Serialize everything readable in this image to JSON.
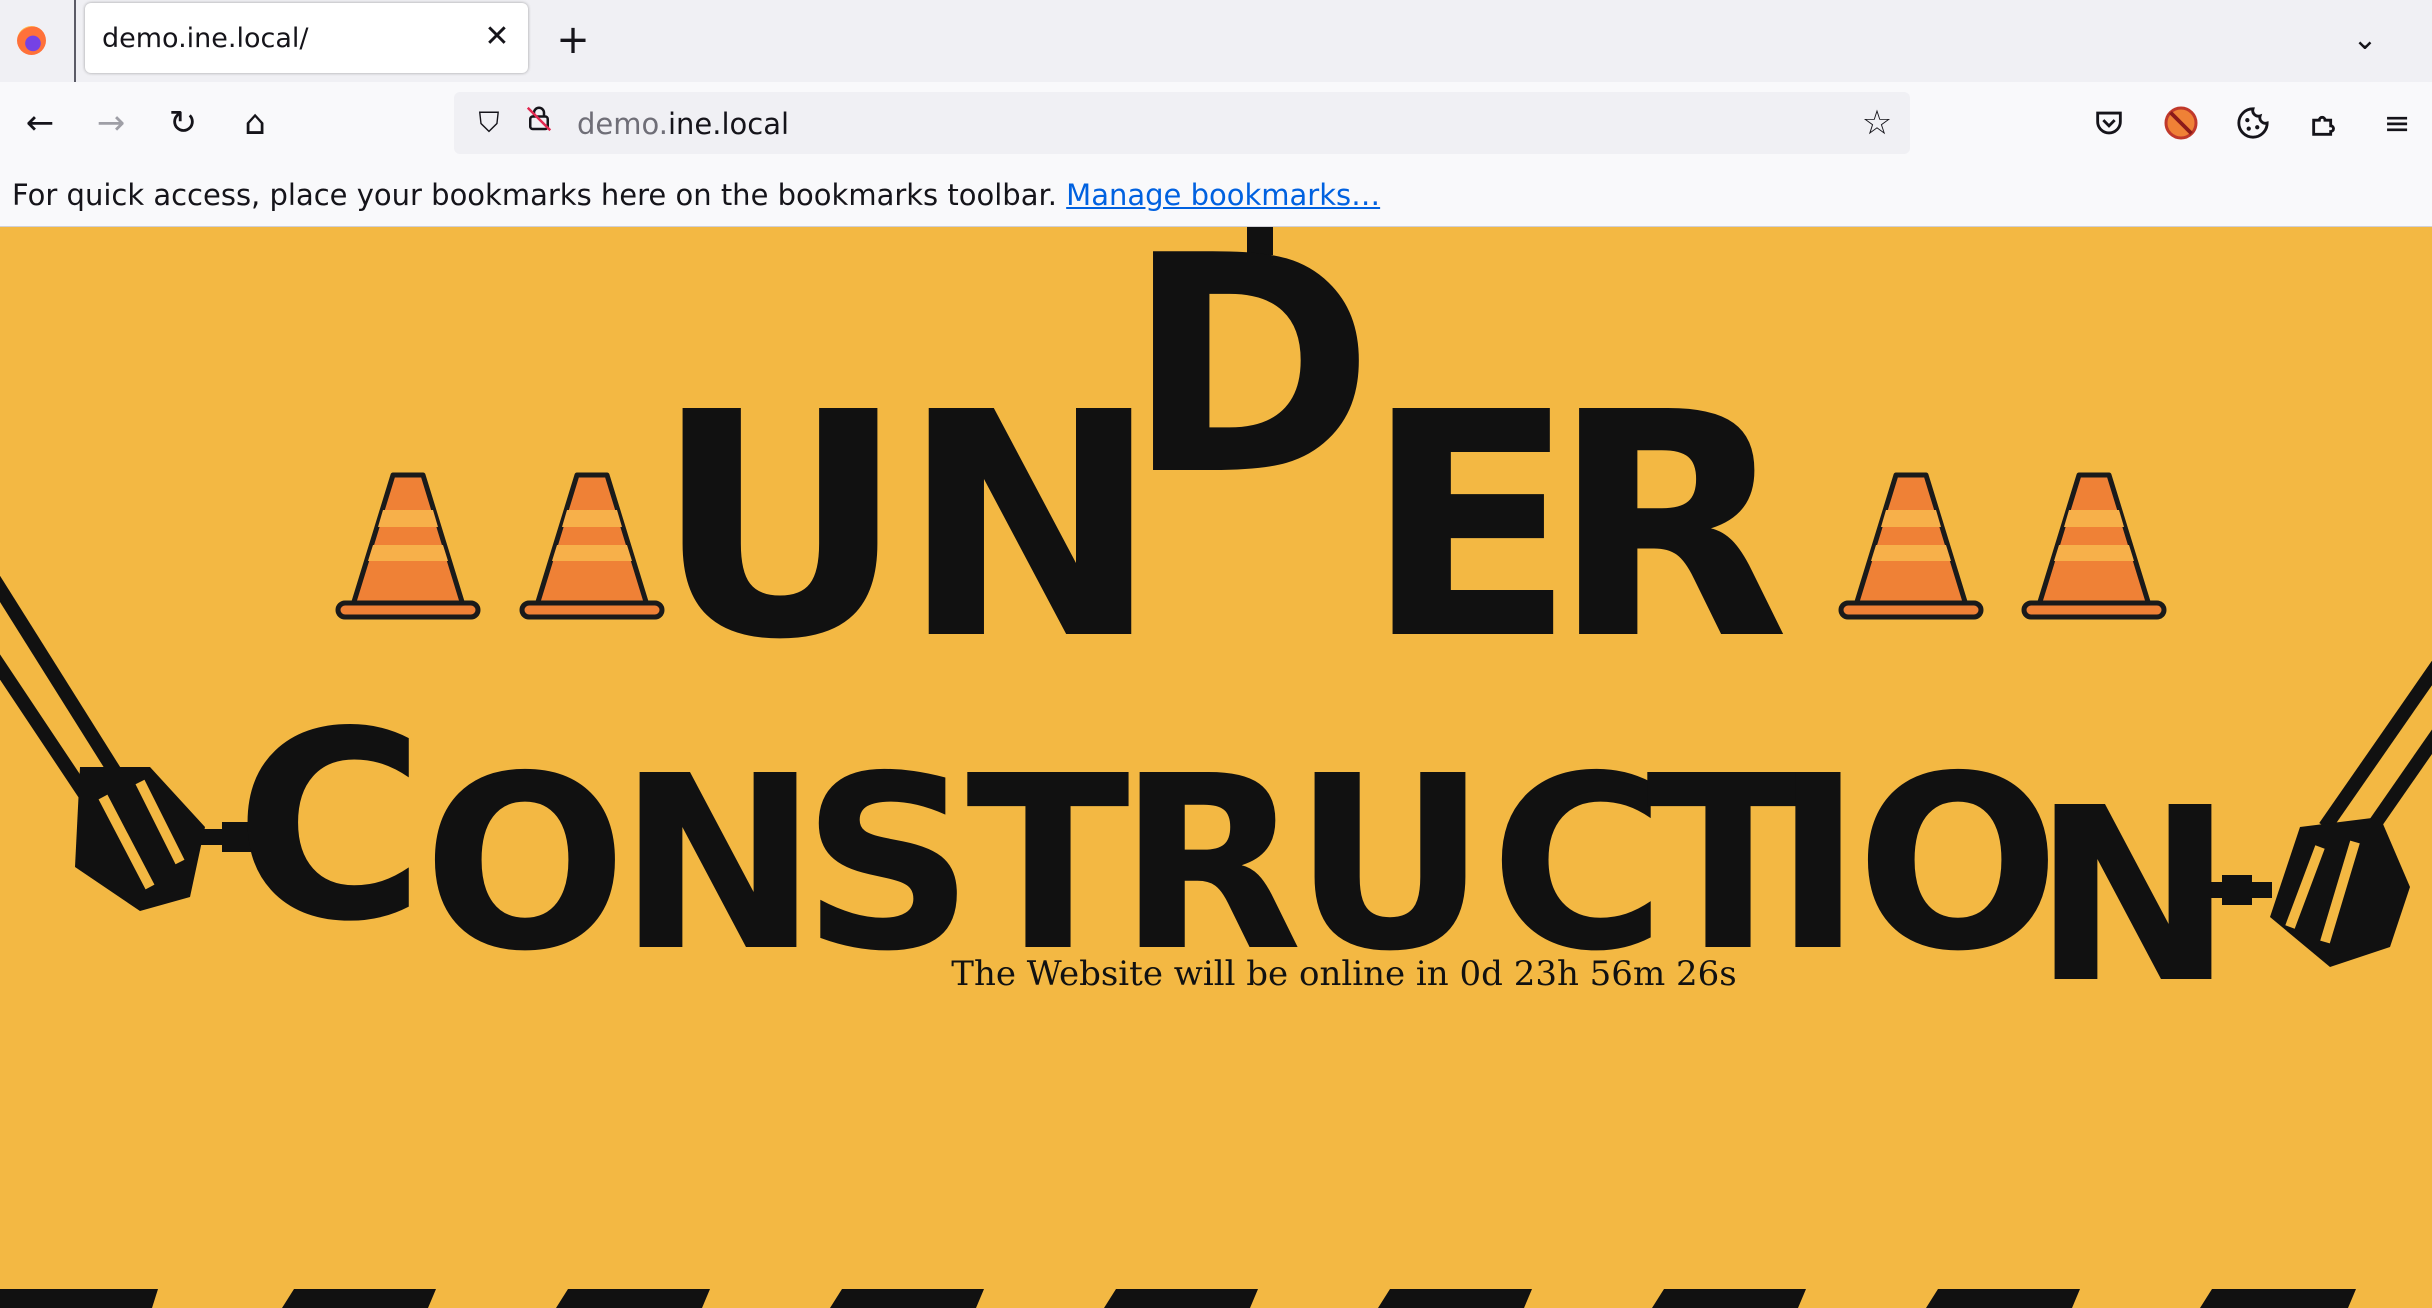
{
  "browser": {
    "tab": {
      "title": "demo.ine.local/",
      "close_icon": "close-icon"
    },
    "new_tab_icon": "plus-icon",
    "tab_list_icon": "chevron-down-icon",
    "nav": {
      "back_icon": "arrow-left-icon",
      "forward_icon": "arrow-right-icon",
      "reload_icon": "reload-icon",
      "home_icon": "home-icon"
    },
    "url": {
      "prefix": "demo.",
      "domain": "ine.local",
      "security_icon": "shield-icon",
      "lock_icon": "insecure-lock-icon",
      "bookmark_icon": "star-icon"
    },
    "toolbar_icons": [
      "pocket-icon",
      "extension-blocker-icon",
      "cookie-icon",
      "extensions-icon",
      "menu-icon"
    ],
    "bookmarks_bar": {
      "message": "For quick access, place your bookmarks here on the bookmarks toolbar.",
      "link": "Manage bookmarks…"
    }
  },
  "page": {
    "background": "#f3b843",
    "heading_line1": [
      "U",
      "N",
      "D",
      "E",
      "R"
    ],
    "heading_line2": [
      "C",
      "O",
      "N",
      "S",
      "T",
      "R",
      "U",
      "C",
      "T",
      "I",
      "O",
      "N"
    ],
    "countdown": "The Website will be online in 0d 23h 56m 26s",
    "cone_colors": {
      "body": "#ef8136",
      "stripe": "#f7b04a",
      "outline": "#1a1a1a"
    }
  }
}
